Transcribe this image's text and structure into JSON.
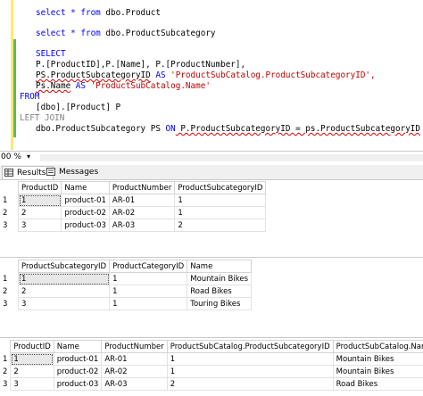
{
  "editor": {
    "lines": [
      {
        "kind": "kw-obj",
        "kw": "select * from ",
        "obj": "dbo.Product"
      },
      {
        "kind": "kw-obj",
        "kw": "select * from ",
        "obj": "dbo.ProductSubcategory"
      },
      {
        "kind": "kw",
        "kw": "SELECT"
      },
      {
        "kind": "text",
        "text": "P.[ProductID],P.[Name], P.[ProductNumber],"
      },
      {
        "kind": "alias",
        "obj": "PS.ProductSubcategoryID",
        "as": " AS ",
        "str": "'ProductSubCatalog.ProductSubcategoryID',"
      },
      {
        "kind": "alias",
        "obj": "Ps.Name",
        "as": " AS ",
        "str": "'ProductSubCatalog.Name'"
      },
      {
        "kind": "kw",
        "kw": "FROM"
      },
      {
        "kind": "text",
        "text": "[dbo].[Product] P"
      },
      {
        "kind": "gray",
        "text": "LEFT JOIN"
      },
      {
        "kind": "join",
        "a": "dbo.ProductSubcategory PS ",
        "on": "ON",
        "b": " P.ProductSubcategoryID = ps.ProductSubcategoryID"
      }
    ]
  },
  "zoom": {
    "value": "00 %",
    "arrow": "▾"
  },
  "tabs": {
    "results": "Results",
    "messages": "Messages"
  },
  "grid1": {
    "headers": [
      "ProductID",
      "Name",
      "ProductNumber",
      "ProductSubcategoryID"
    ],
    "rows": [
      [
        "1",
        "1",
        "product-01",
        "AR-01",
        "1"
      ],
      [
        "2",
        "2",
        "product-02",
        "AR-02",
        "1"
      ],
      [
        "3",
        "3",
        "product-03",
        "AR-03",
        "2"
      ]
    ]
  },
  "grid2": {
    "headers": [
      "ProductSubcategoryID",
      "ProductCategoryID",
      "Name"
    ],
    "rows": [
      [
        "1",
        "1",
        "1",
        "Mountain Bikes"
      ],
      [
        "2",
        "2",
        "1",
        "Road Bikes"
      ],
      [
        "3",
        "3",
        "1",
        "Touring Bikes"
      ]
    ]
  },
  "grid3": {
    "headers": [
      "ProductID",
      "Name",
      "ProductNumber",
      "ProductSubCatalog.ProductSubcategoryID",
      "ProductSubCatalog.Name"
    ],
    "rows": [
      [
        "1",
        "1",
        "product-01",
        "AR-01",
        "1",
        "Mountain Bikes"
      ],
      [
        "2",
        "2",
        "product-02",
        "AR-02",
        "1",
        "Mountain Bikes"
      ],
      [
        "3",
        "3",
        "product-03",
        "AR-03",
        "2",
        "Road Bikes"
      ]
    ]
  }
}
